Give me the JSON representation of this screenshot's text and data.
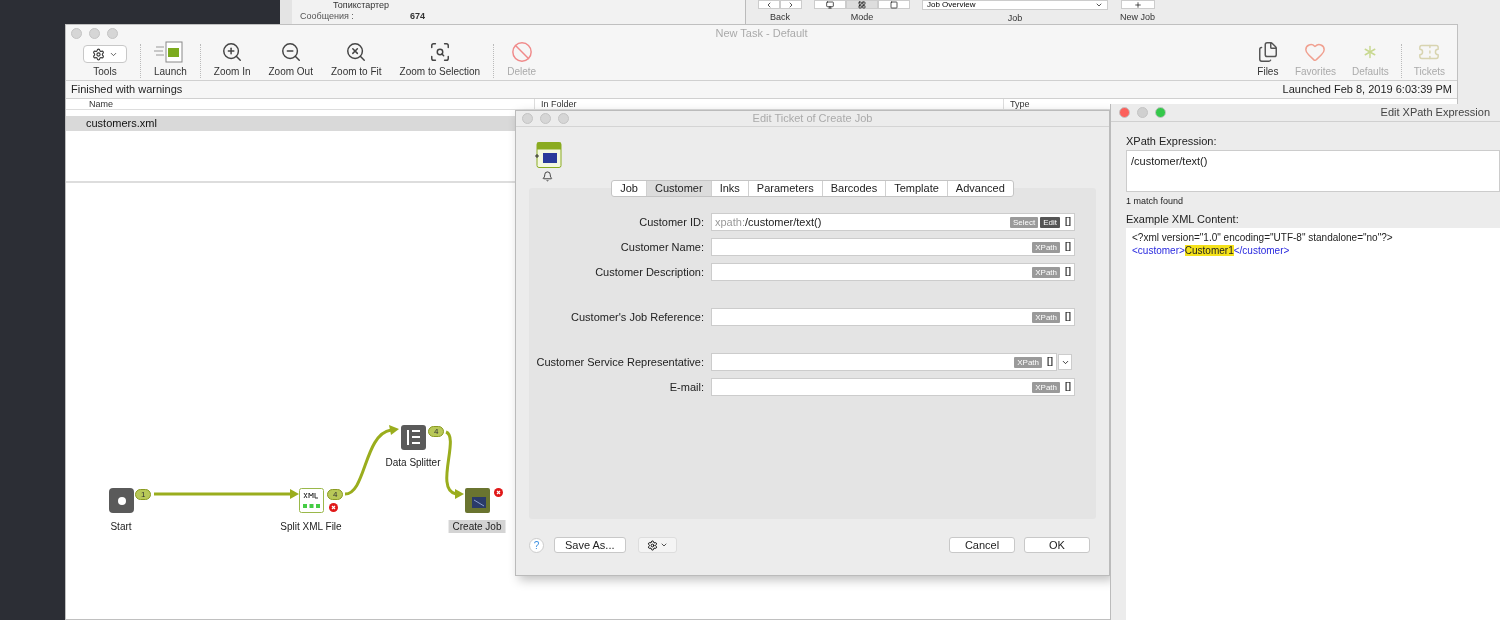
{
  "forum_window": {
    "role_label": "Топикстартер",
    "messages_label": "Сообщения :",
    "messages_count": "674"
  },
  "job_window": {
    "toolbar": [
      {
        "kind": "nav",
        "label": "Back"
      },
      {
        "kind": "mode",
        "label": "Mode",
        "segments": [
          {
            "selected": false
          },
          {
            "selected": true
          },
          {
            "selected": false
          }
        ]
      },
      {
        "kind": "job",
        "label": "Job",
        "value": "Job Overview"
      },
      {
        "kind": "new",
        "label": "New Job"
      }
    ]
  },
  "main_window": {
    "title": "New Task - Default",
    "toolbar_left": [
      {
        "kind": "gear",
        "label": "Tools",
        "disabled": false
      },
      {
        "kind": "launch",
        "label": "Launch",
        "disabled": false
      },
      {
        "kind": "zoomin",
        "label": "Zoom In",
        "disabled": false
      },
      {
        "kind": "zoomout",
        "label": "Zoom Out",
        "disabled": false
      },
      {
        "kind": "fit",
        "label": "Zoom to Fit",
        "disabled": false
      },
      {
        "kind": "selection",
        "label": "Zoom to Selection",
        "disabled": false
      },
      {
        "kind": "delete",
        "label": "Delete",
        "disabled": true
      }
    ],
    "toolbar_right": [
      {
        "kind": "files",
        "label": "Files",
        "disabled": false
      },
      {
        "kind": "favorites",
        "label": "Favorites",
        "disabled": true
      },
      {
        "kind": "defaults",
        "label": "Defaults",
        "disabled": true
      },
      {
        "kind": "tickets",
        "label": "Tickets",
        "disabled": true
      }
    ],
    "status": "Finished with warnings",
    "launched": "Launched Feb 8, 2019 6:03:39 PM",
    "table": {
      "columns": [
        "Name",
        "In Folder",
        "Type"
      ],
      "rows": [
        {
          "name": "customers.xml",
          "selected": true
        }
      ]
    },
    "flow": {
      "nodes": [
        {
          "kind": "start",
          "label": "Start",
          "selected": false,
          "error": false
        },
        {
          "kind": "xml",
          "label": "Split XML File",
          "selected": false,
          "error": true
        },
        {
          "kind": "splitter",
          "label": "Data Splitter",
          "selected": false,
          "error": false
        },
        {
          "kind": "job",
          "label": "Create Job",
          "selected": true,
          "error": true
        }
      ],
      "connections": [
        {
          "count": "1"
        },
        {
          "count": "4"
        },
        {
          "count": "4"
        }
      ]
    }
  },
  "ticket_dialog": {
    "title": "Edit Ticket of Create Job",
    "tabs": [
      {
        "label": "Job",
        "selected": false
      },
      {
        "label": "Customer",
        "selected": true
      },
      {
        "label": "Inks",
        "selected": false
      },
      {
        "label": "Parameters",
        "selected": false
      },
      {
        "label": "Barcodes",
        "selected": false
      },
      {
        "label": "Template",
        "selected": false
      },
      {
        "label": "Advanced",
        "selected": false
      }
    ],
    "field_groups": [
      [
        {
          "label": "Customer ID:",
          "prefix": "xpath:",
          "value": "/customer/text()",
          "buttons": [
            {
              "label": "Select",
              "kind": "plain"
            },
            {
              "label": "Edit",
              "kind": "strong"
            }
          ],
          "bracket": "[]",
          "dropdown": false
        },
        {
          "label": "Customer Name:",
          "buttons": [
            {
              "label": "XPath",
              "kind": "plain"
            }
          ],
          "bracket": "[]",
          "dropdown": false
        },
        {
          "label": "Customer Description:",
          "buttons": [
            {
              "label": "XPath",
              "kind": "plain"
            }
          ],
          "bracket": "[]",
          "dropdown": false
        }
      ],
      [
        {
          "label": "Customer's Job Reference:",
          "buttons": [
            {
              "label": "XPath",
              "kind": "plain"
            }
          ],
          "bracket": "[]",
          "dropdown": false
        }
      ],
      [
        {
          "label": "Customer Service Representative:",
          "buttons": [
            {
              "label": "XPath",
              "kind": "plain"
            }
          ],
          "bracket": "[]",
          "dropdown": true
        },
        {
          "label": "E-mail:",
          "buttons": [
            {
              "label": "XPath",
              "kind": "plain"
            }
          ],
          "bracket": "[]",
          "dropdown": false
        }
      ]
    ],
    "help": "?",
    "save_as": "Save As...",
    "cancel": "Cancel",
    "ok": "OK"
  },
  "xpath_window": {
    "title": "Edit XPath Expression",
    "expression_label": "XPath Expression:",
    "expression": "/customer/text()",
    "match_count": "1 match found",
    "xml_label": "Example XML Content:",
    "xml_lines": [
      [
        {
          "kind": "text",
          "text": "<?xml version=\"1.0\" encoding=\"UTF-8\" standalone=\"no\"?>"
        }
      ],
      [
        {
          "kind": "tag",
          "text": "<customer>"
        },
        {
          "kind": "match",
          "text": "Customer1"
        },
        {
          "kind": "tag",
          "text": "</customer>"
        }
      ]
    ]
  }
}
